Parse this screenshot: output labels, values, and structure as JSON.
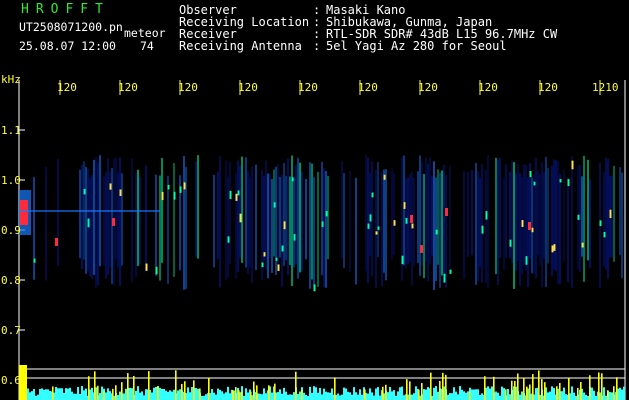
{
  "header": {
    "app_title": "HROFFT",
    "file_name": "UT2508071200.pn",
    "file_type": "meteor",
    "timestamp": "25.08.07 12:00",
    "count": "74"
  },
  "info": [
    {
      "label": "Observer",
      "sep": ":",
      "value": "Masaki Kano"
    },
    {
      "label": "Receiving Location",
      "sep": ":",
      "value": "Shibukawa, Gunma, Japan"
    },
    {
      "label": "Receiver",
      "sep": ":",
      "value": "RTL-SDR SDR# 43dB L15 96.7MHz CW"
    },
    {
      "label": "Receiving Antenna",
      "sep": ":",
      "value": "5el Yagi Az 280 for Seoul"
    }
  ],
  "axes": {
    "y_unit": "kHz",
    "y_ticks": [
      "1.1",
      "1.0",
      "0.9",
      "0.8",
      "0.7",
      "0.6"
    ],
    "x_ticks": [
      "120",
      "120",
      "120",
      "120",
      "120",
      "120",
      "120",
      "120",
      "120",
      "1210"
    ]
  },
  "colors": {
    "background": "#000000",
    "title": "#2ee82e",
    "axis_text": "#ffff33",
    "waterfall_weak": "#0a1a9a",
    "waterfall_mid": "#1a7bff",
    "waterfall_strong": "#00ffaa",
    "waterfall_peak": "#ff2a3a",
    "level_fill": "#33ffff",
    "level_peak": "#ffff00"
  }
}
